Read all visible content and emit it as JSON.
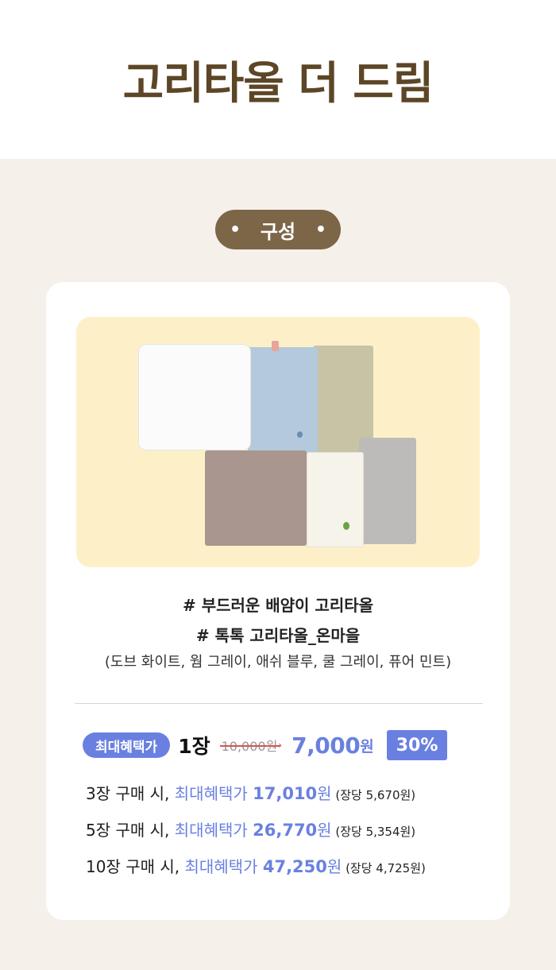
{
  "header": {
    "title": "고리타올 더 드림"
  },
  "section": {
    "dot_left": "•",
    "label": "구성",
    "dot_right": "•"
  },
  "colors": {
    "brown": "#5c4626",
    "pill": "#7d6548",
    "accent": "#6a80e0",
    "cream": "#fdf0c9",
    "bg": "#f5f1ea"
  },
  "product": {
    "image_alt": "six towels in white, blue, green, taupe, ivory and grey",
    "line1": "# 부드러운 배얌이 고리타올",
    "line2": "# 톡톡 고리타올_온마을",
    "colors_note": "(도브 화이트, 웜 그레이, 애쉬 블루, 쿨 그레이, 퓨어 민트)"
  },
  "pricing": {
    "badge": "최대혜택가",
    "qty": "1장",
    "original": "10,000원",
    "arrow": "›",
    "sale_amount": "7,000",
    "sale_unit": "원",
    "discount": "30%"
  },
  "tiers": [
    {
      "prefix": "3장 구매 시, ",
      "label": "최대혜택가 ",
      "amount": "17,010",
      "unit": "원",
      "per": " (장당 5,670원)"
    },
    {
      "prefix": "5장 구매 시, ",
      "label": "최대혜택가  ",
      "amount": "26,770",
      "unit": "원",
      "per": " (장당 5,354원)"
    },
    {
      "prefix": "10장 구매 시, ",
      "label": "최대혜택가 ",
      "amount": "47,250",
      "unit": "원",
      "per": " (장당 4,725원)"
    }
  ]
}
